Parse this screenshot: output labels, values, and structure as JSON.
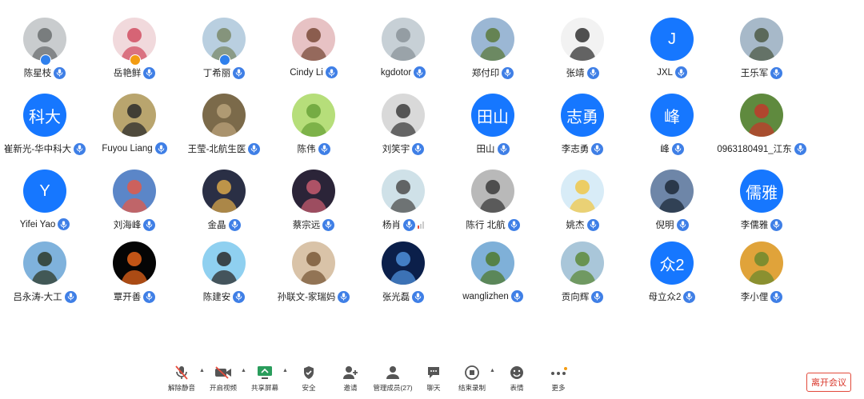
{
  "participants": [
    {
      "name": "陈星枝",
      "avatar": {
        "type": "photo",
        "bg": "#c9ccce",
        "fg": "#6b6f70"
      },
      "badge": "#2f80ed"
    },
    {
      "name": "岳艳鲜",
      "avatar": {
        "type": "photo",
        "bg": "#f1d9dc",
        "fg": "#d14f63"
      },
      "badge": "#f39c12"
    },
    {
      "name": "丁希丽",
      "avatar": {
        "type": "photo",
        "bg": "#b9cfe0",
        "fg": "#7b8a6a"
      },
      "badge": "#2f80ed"
    },
    {
      "name": "Cindy Li",
      "avatar": {
        "type": "photo",
        "bg": "#e7c2c4",
        "fg": "#7a4b3a"
      }
    },
    {
      "name": "kgdotor",
      "avatar": {
        "type": "photo",
        "bg": "#c7d0d6",
        "fg": "#8b949a"
      }
    },
    {
      "name": "郑付印",
      "avatar": {
        "type": "photo",
        "bg": "#9bb7d4",
        "fg": "#5c7a3c"
      }
    },
    {
      "name": "张靖",
      "avatar": {
        "type": "photo",
        "bg": "#f2f2f2",
        "fg": "#333333"
      }
    },
    {
      "name": "JXL",
      "avatar": {
        "type": "initial",
        "text": "J"
      }
    },
    {
      "name": "王乐军",
      "avatar": {
        "type": "photo",
        "bg": "#a7b9c9",
        "fg": "#4e5b46"
      }
    },
    {
      "name": "崔新光-华中科大",
      "avatar": {
        "type": "initial",
        "text": "科大"
      }
    },
    {
      "name": "Fuyou Liang",
      "avatar": {
        "type": "photo",
        "bg": "#b9a56e",
        "fg": "#2c2c2c"
      }
    },
    {
      "name": "王莹-北航生医",
      "avatar": {
        "type": "photo",
        "bg": "#7b6a4a",
        "fg": "#b9a27a"
      }
    },
    {
      "name": "陈伟",
      "avatar": {
        "type": "photo",
        "bg": "#b6de7a",
        "fg": "#6aa33a"
      }
    },
    {
      "name": "刘笑宇",
      "avatar": {
        "type": "photo",
        "bg": "#d9d9d9",
        "fg": "#3d3d3d"
      }
    },
    {
      "name": "田山",
      "avatar": {
        "type": "initial",
        "text": "田山"
      }
    },
    {
      "name": "李志勇",
      "avatar": {
        "type": "initial",
        "text": "志勇"
      }
    },
    {
      "name": "峰",
      "avatar": {
        "type": "initial",
        "text": "峰"
      }
    },
    {
      "name": "0963180491_江东",
      "avatar": {
        "type": "photo",
        "bg": "#5f8a3e",
        "fg": "#c0392b"
      }
    },
    {
      "name": "Yifei Yao",
      "avatar": {
        "type": "initial",
        "text": "Y"
      }
    },
    {
      "name": "刘海峰",
      "avatar": {
        "type": "photo",
        "bg": "#5b86c8",
        "fg": "#e05a4a"
      }
    },
    {
      "name": "金晶",
      "avatar": {
        "type": "photo",
        "bg": "#2a2f45",
        "fg": "#d7a64a"
      }
    },
    {
      "name": "蔡宗远",
      "avatar": {
        "type": "photo",
        "bg": "#2b2438",
        "fg": "#c45b6e"
      }
    },
    {
      "name": "杨肖",
      "avatar": {
        "type": "photo",
        "bg": "#cfe1e8",
        "fg": "#4d4d4d"
      },
      "signal": true
    },
    {
      "name": "陈行 北航",
      "avatar": {
        "type": "photo",
        "bg": "#b9b9b9",
        "fg": "#3b3b3b"
      }
    },
    {
      "name": "姚杰",
      "avatar": {
        "type": "photo",
        "bg": "#d8ecf7",
        "fg": "#f0c84a"
      }
    },
    {
      "name": "倪明",
      "avatar": {
        "type": "photo",
        "bg": "#6e86a8",
        "fg": "#1e2a3a"
      }
    },
    {
      "name": "李儒雅",
      "avatar": {
        "type": "initial",
        "text": "儒雅"
      }
    },
    {
      "name": "吕永涛-大工",
      "avatar": {
        "type": "photo",
        "bg": "#7fb2dc",
        "fg": "#2d3a2a"
      }
    },
    {
      "name": "覃开善",
      "avatar": {
        "type": "photo",
        "bg": "#050505",
        "fg": "#e3631a"
      }
    },
    {
      "name": "陈建安",
      "avatar": {
        "type": "photo",
        "bg": "#8fd0f0",
        "fg": "#2b2b2b"
      }
    },
    {
      "name": "孙联文-家瑞妈",
      "avatar": {
        "type": "photo",
        "bg": "#d9c3a8",
        "fg": "#7a5a3a"
      }
    },
    {
      "name": "张光磊",
      "avatar": {
        "type": "photo",
        "bg": "#0b1f4a",
        "fg": "#4e8fd9"
      }
    },
    {
      "name": "wanglizhen",
      "avatar": {
        "type": "photo",
        "bg": "#7fb0d8",
        "fg": "#4f7a2f"
      }
    },
    {
      "name": "贡向辉",
      "avatar": {
        "type": "photo",
        "bg": "#a9c6d9",
        "fg": "#5e8a3a"
      }
    },
    {
      "name": "母立众2",
      "avatar": {
        "type": "initial",
        "text": "众2"
      }
    },
    {
      "name": "李小俚",
      "avatar": {
        "type": "photo",
        "bg": "#e0a33a",
        "fg": "#6d8a2e"
      }
    }
  ],
  "toolbar": {
    "items": [
      {
        "id": "unmute",
        "label": "解除静音",
        "icon": "mic-muted-icon",
        "caret": true
      },
      {
        "id": "video",
        "label": "开启视频",
        "icon": "video-off-icon",
        "caret": true
      },
      {
        "id": "share",
        "label": "共享屏幕",
        "icon": "share-screen-icon",
        "caret": true
      },
      {
        "id": "security",
        "label": "安全",
        "icon": "shield-icon"
      },
      {
        "id": "invite",
        "label": "邀请",
        "icon": "invite-icon"
      },
      {
        "id": "members",
        "label": "管理成员(27)",
        "icon": "members-icon"
      },
      {
        "id": "chat",
        "label": "聊天",
        "icon": "chat-icon"
      },
      {
        "id": "record",
        "label": "结束录制",
        "icon": "stop-record-icon",
        "caret": true
      },
      {
        "id": "emoji",
        "label": "表情",
        "icon": "emoji-icon"
      },
      {
        "id": "more",
        "label": "更多",
        "icon": "more-icon"
      }
    ],
    "leave_label": "离开会议"
  },
  "colors": {
    "accent": "#1677ff",
    "leave": "#e24a3b",
    "record": "#e84b3c"
  }
}
